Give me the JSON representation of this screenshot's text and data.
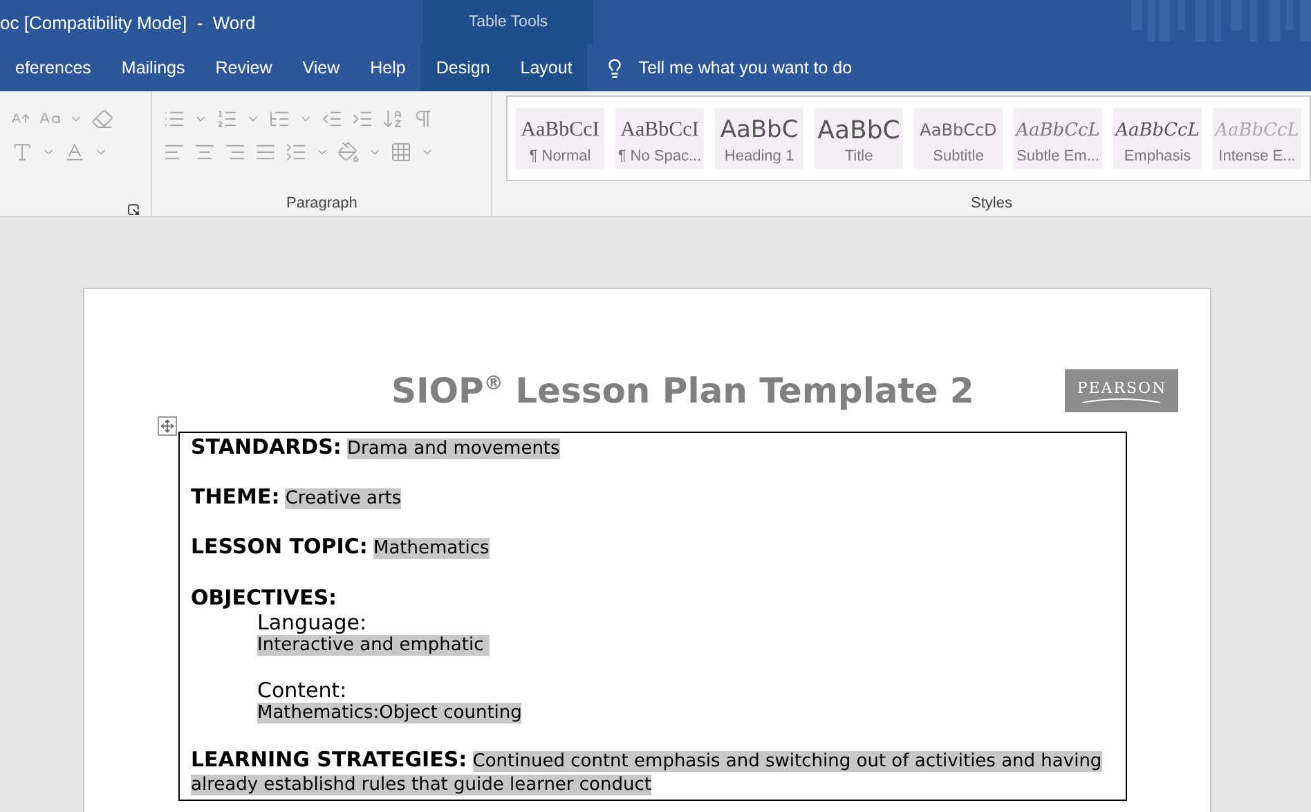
{
  "window": {
    "title": "oc [Compatibility Mode]  -  Word",
    "context_header": "Table Tools"
  },
  "tabs": [
    {
      "label": "eferences",
      "contextual": false
    },
    {
      "label": "Mailings",
      "contextual": false
    },
    {
      "label": "Review",
      "contextual": false
    },
    {
      "label": "View",
      "contextual": false
    },
    {
      "label": "Help",
      "contextual": false
    },
    {
      "label": "Design",
      "contextual": true
    },
    {
      "label": "Layout",
      "contextual": true
    }
  ],
  "tell_me": {
    "placeholder": "Tell me what you want to do"
  },
  "ribbon": {
    "paragraph_label": "Paragraph",
    "styles_label": "Styles",
    "styles": [
      {
        "sample": "AaBbCcI",
        "name": "¶ Normal",
        "kind": "normal"
      },
      {
        "sample": "AaBbCcI",
        "name": "¶ No Spac...",
        "kind": "normal"
      },
      {
        "sample": "AaBbC",
        "name": "Heading 1",
        "kind": "heading"
      },
      {
        "sample": "AaBbC",
        "name": "Title",
        "kind": "title"
      },
      {
        "sample": "AaBbCcD",
        "name": "Subtitle",
        "kind": "subtitle"
      },
      {
        "sample": "AaBbCcL",
        "name": "Subtle Em...",
        "kind": "italic"
      },
      {
        "sample": "AaBbCcL",
        "name": "Emphasis",
        "kind": "emphasis"
      },
      {
        "sample": "AaBbCcL",
        "name": "Intense E...",
        "kind": "faded"
      }
    ]
  },
  "document": {
    "title": "SIOP$^{®}$ Lesson Plan Template 2",
    "logo": "PEARSON",
    "fields": [
      {
        "label": "STANDARDS:",
        "value": "Drama and movements"
      },
      {
        "label": "THEME:",
        "value": "Creative arts"
      },
      {
        "label": "LESSON TOPIC:",
        "value": "Mathematics"
      }
    ],
    "objectives": {
      "label": "OBJECTIVES:",
      "items": [
        {
          "label": "Language:",
          "value": "Interactive and emphatic "
        },
        {
          "label": "Content:",
          "value": "Mathematics:Object counting"
        }
      ]
    },
    "strategies": {
      "label": "LEARNING STRATEGIES:",
      "value": "Continued contnt emphasis and switching out of activities and having already establishd rules that guide learner conduct"
    }
  }
}
